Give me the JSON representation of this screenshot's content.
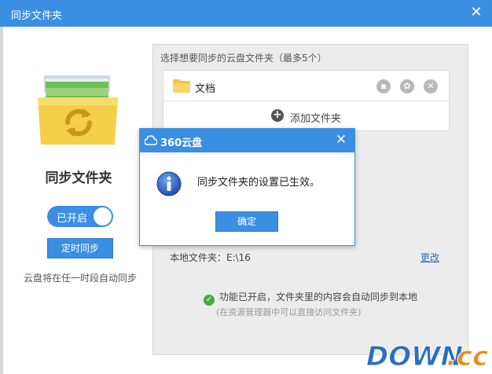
{
  "window": {
    "title": "同步文件夹",
    "close_icon": "close-icon"
  },
  "left": {
    "heading": "同步文件夹",
    "toggle_label": "已开启",
    "schedule_button": "定时同步",
    "description": "云盘将在任一时段自动同步"
  },
  "panel": {
    "hint": "选择想要同步的云盘文件夹（最多5个）",
    "folders": [
      {
        "name": "文档",
        "icon": "folder-icon",
        "actions": [
          "open-folder-icon",
          "settings-icon",
          "remove-icon"
        ]
      }
    ],
    "add_folder": "添加文件夹",
    "local_folder_label": "本地文件夹：E:\\16",
    "change_link": "更改",
    "status": "功能已开启，文件夹里的内容会自动同步到本地",
    "substatus": "(在资源管理器中可以直接访问文件夹)"
  },
  "dialog": {
    "title": "360云盘",
    "message": "同步文件夹的设置已生效。",
    "ok_button": "确定"
  },
  "watermark": {
    "text": "DOWN.cc"
  },
  "colors": {
    "accent": "#3b8fe2",
    "success": "#3fae3a",
    "link": "#2d6cc0"
  }
}
